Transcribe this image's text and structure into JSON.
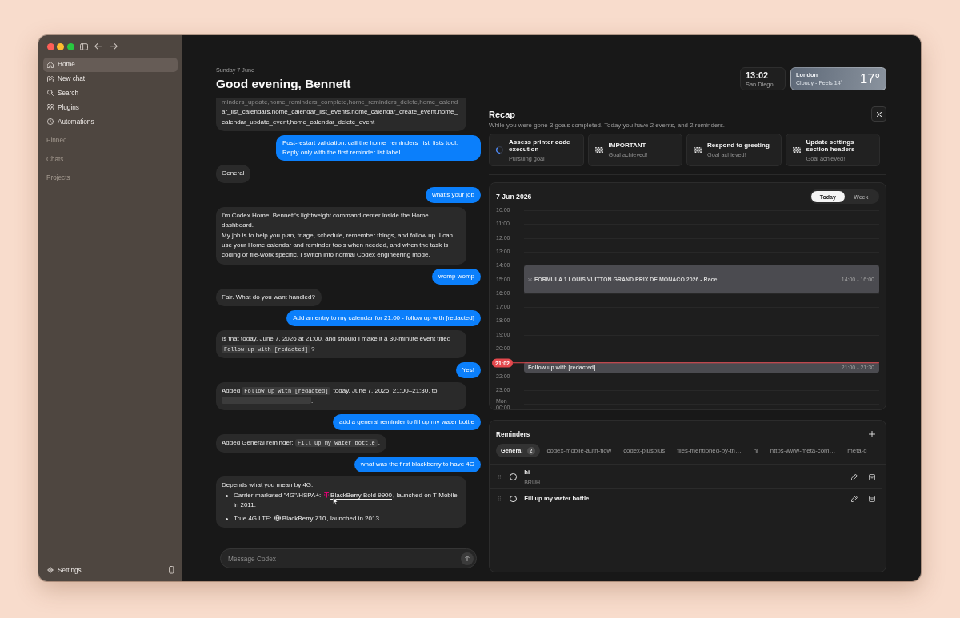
{
  "sidebar": {
    "nav": [
      {
        "kind": "home",
        "label": "Home",
        "selected": true
      },
      {
        "kind": "new_chat",
        "label": "New chat",
        "selected": false
      },
      {
        "kind": "search",
        "label": "Search",
        "selected": false
      },
      {
        "kind": "plugins",
        "label": "Plugins",
        "selected": false
      },
      {
        "kind": "automations",
        "label": "Automations",
        "selected": false
      }
    ],
    "sections": [
      "Pinned",
      "Chats",
      "Projects"
    ],
    "settings": "Settings"
  },
  "header": {
    "date": "Sunday 7 June",
    "greeting": "Good evening, Bennett"
  },
  "clock": {
    "time": "13:02",
    "city": "San Diego"
  },
  "weather": {
    "city": "London",
    "condition": "Cloudy - Feels 14°",
    "temperature": "17°"
  },
  "chat": {
    "messages": [
      {
        "kind": "reply",
        "cut_top": true,
        "paragraphs": [
          [
            {
              "kind": "faded",
              "text": "minders_update,home_reminders_complete,home_reminders_delete,home_calend"
            }
          ],
          [
            {
              "kind": "text",
              "text": "ar_list_calendars,home_calendar_list_events,home_calendar_create_event,home_calendar_update_event,home_calendar_delete_event"
            }
          ]
        ]
      },
      {
        "kind": "sent",
        "paragraphs": [
          [
            {
              "kind": "text",
              "text": "Post-restart validation: call the home_reminders_list_lists tool. Reply only with the first reminder list label."
            }
          ]
        ]
      },
      {
        "kind": "reply",
        "paragraphs": [
          [
            {
              "kind": "text",
              "text": "General"
            }
          ]
        ]
      },
      {
        "kind": "sent",
        "paragraphs": [
          [
            {
              "kind": "text",
              "text": "what's your job"
            }
          ]
        ]
      },
      {
        "kind": "reply",
        "paragraphs": [
          [
            {
              "kind": "text",
              "text": "I'm Codex Home: Bennett's lightweight command center inside the Home dashboard."
            }
          ],
          [
            {
              "kind": "text",
              "text": "My job is to help you plan, triage, schedule, remember things, and follow up. I can use your Home calendar and reminder tools when needed, and when the task is coding or file-work specific, I switch into normal Codex engineering mode."
            }
          ]
        ]
      },
      {
        "kind": "sent",
        "paragraphs": [
          [
            {
              "kind": "text",
              "text": "womp womp"
            }
          ]
        ]
      },
      {
        "kind": "reply",
        "paragraphs": [
          [
            {
              "kind": "text",
              "text": "Fair. What do you want handled?"
            }
          ]
        ]
      },
      {
        "kind": "sent",
        "paragraphs": [
          [
            {
              "kind": "text",
              "text": "Add an entry to my calendar for 21:00 - follow up with [redacted]"
            }
          ]
        ]
      },
      {
        "kind": "reply",
        "paragraphs": [
          [
            {
              "kind": "text",
              "text": "Is that today, June 7, 2026 at 21:00, and should I make it a 30-minute event titled "
            },
            {
              "kind": "code",
              "text": "Follow up with [redacted]"
            },
            {
              "kind": "text",
              "text": "?"
            }
          ]
        ]
      },
      {
        "kind": "sent",
        "paragraphs": [
          [
            {
              "kind": "text",
              "text": "Yes!"
            }
          ]
        ]
      },
      {
        "kind": "reply",
        "paragraphs": [
          [
            {
              "kind": "text",
              "text": "Added "
            },
            {
              "kind": "code",
              "text": "Follow up with [redacted]"
            },
            {
              "kind": "text",
              "text": " today, June 7, 2026, 21:00–21:30, to "
            },
            {
              "kind": "redacted"
            },
            {
              "kind": "text",
              "text": "."
            }
          ]
        ]
      },
      {
        "kind": "sent",
        "paragraphs": [
          [
            {
              "kind": "text",
              "text": "add a general reminder to fill up my water bottle"
            }
          ]
        ]
      },
      {
        "kind": "reply",
        "paragraphs": [
          [
            {
              "kind": "text",
              "text": "Added General reminder: "
            },
            {
              "kind": "code",
              "text": "Fill up my water bottle"
            },
            {
              "kind": "text",
              "text": "."
            }
          ]
        ]
      },
      {
        "kind": "sent",
        "paragraphs": [
          [
            {
              "kind": "text",
              "text": "what was the first blackberry to have 4G"
            }
          ]
        ]
      },
      {
        "kind": "reply",
        "paragraphs": [
          [
            {
              "kind": "text",
              "text": "Depends what you mean by 4G:"
            }
          ]
        ],
        "bullets": [
          [
            {
              "kind": "text",
              "text": "Carrier-marketed \"4G\"/HSPA+: "
            },
            {
              "kind": "brand_link",
              "text": "BlackBerry Bold 9900",
              "hovered": true
            },
            {
              "kind": "text",
              "text": ", launched on T-Mobile in 2011."
            }
          ],
          [
            {
              "kind": "text",
              "text": "True 4G LTE: "
            },
            {
              "kind": "web_link",
              "text": "BlackBerry Z10",
              "hovered": false
            },
            {
              "kind": "text",
              "text": ", launched in 2013."
            }
          ]
        ]
      }
    ],
    "composer": {
      "placeholder": "Message Codex"
    }
  },
  "recap": {
    "title": "Recap",
    "summary": "While you were gone 3 goals completed. Today you have 2 events, and 2 reminders.",
    "goals": [
      {
        "kind": "pursuing",
        "title": "Assess printer code execution",
        "status": "Pursuing goal"
      },
      {
        "kind": "achieved",
        "title": "IMPORTANT",
        "status": "Goal achieved!"
      },
      {
        "kind": "achieved",
        "title": "Respond to greeting",
        "status": "Goal achieved!"
      },
      {
        "kind": "achieved",
        "title": "Update settings section headers",
        "status": "Goal achieved!"
      }
    ]
  },
  "calendar": {
    "date": "7 Jun 2026",
    "views": [
      {
        "label": "Today",
        "selected": true
      },
      {
        "label": "Week",
        "selected": false
      }
    ],
    "hours": [
      {
        "time": "10:00"
      },
      {
        "time": "11:00"
      },
      {
        "time": "12:00"
      },
      {
        "time": "13:00"
      },
      {
        "time": "14:00"
      },
      {
        "time": "15:00"
      },
      {
        "time": "16:00"
      },
      {
        "time": "17:00"
      },
      {
        "time": "18:00"
      },
      {
        "time": "19:00"
      },
      {
        "time": "20:00"
      },
      {
        "time": "22:00"
      },
      {
        "time": "23:00"
      },
      {
        "day": "Mon",
        "time": "00:00"
      }
    ],
    "events": [
      {
        "kind": "feed",
        "title": "FORMULA 1 LOUIS VUITTON GRAND PRIX DE MONACO 2026 - Race",
        "time": "14:00 - 16:00"
      },
      {
        "kind": "local",
        "title": "Follow up with [redacted]",
        "time": "21:00 - 21:30"
      }
    ],
    "now": "21:02"
  },
  "reminders": {
    "title": "Reminders",
    "lists": [
      {
        "label": "General",
        "count": "2",
        "selected": true
      },
      {
        "label": "codex-mobile-auth-flow",
        "selected": false
      },
      {
        "label": "codex-plusplus",
        "selected": false
      },
      {
        "label": "files-mentioned-by-th…",
        "selected": false
      },
      {
        "label": "hi",
        "selected": false
      },
      {
        "label": "https-www-meta-com…",
        "selected": false
      },
      {
        "label": "meta-d",
        "selected": false
      }
    ],
    "items": [
      {
        "title": "hi",
        "note": "BRUH",
        "completed": false
      },
      {
        "title": "Fill up my water bottle",
        "completed": false
      }
    ]
  }
}
